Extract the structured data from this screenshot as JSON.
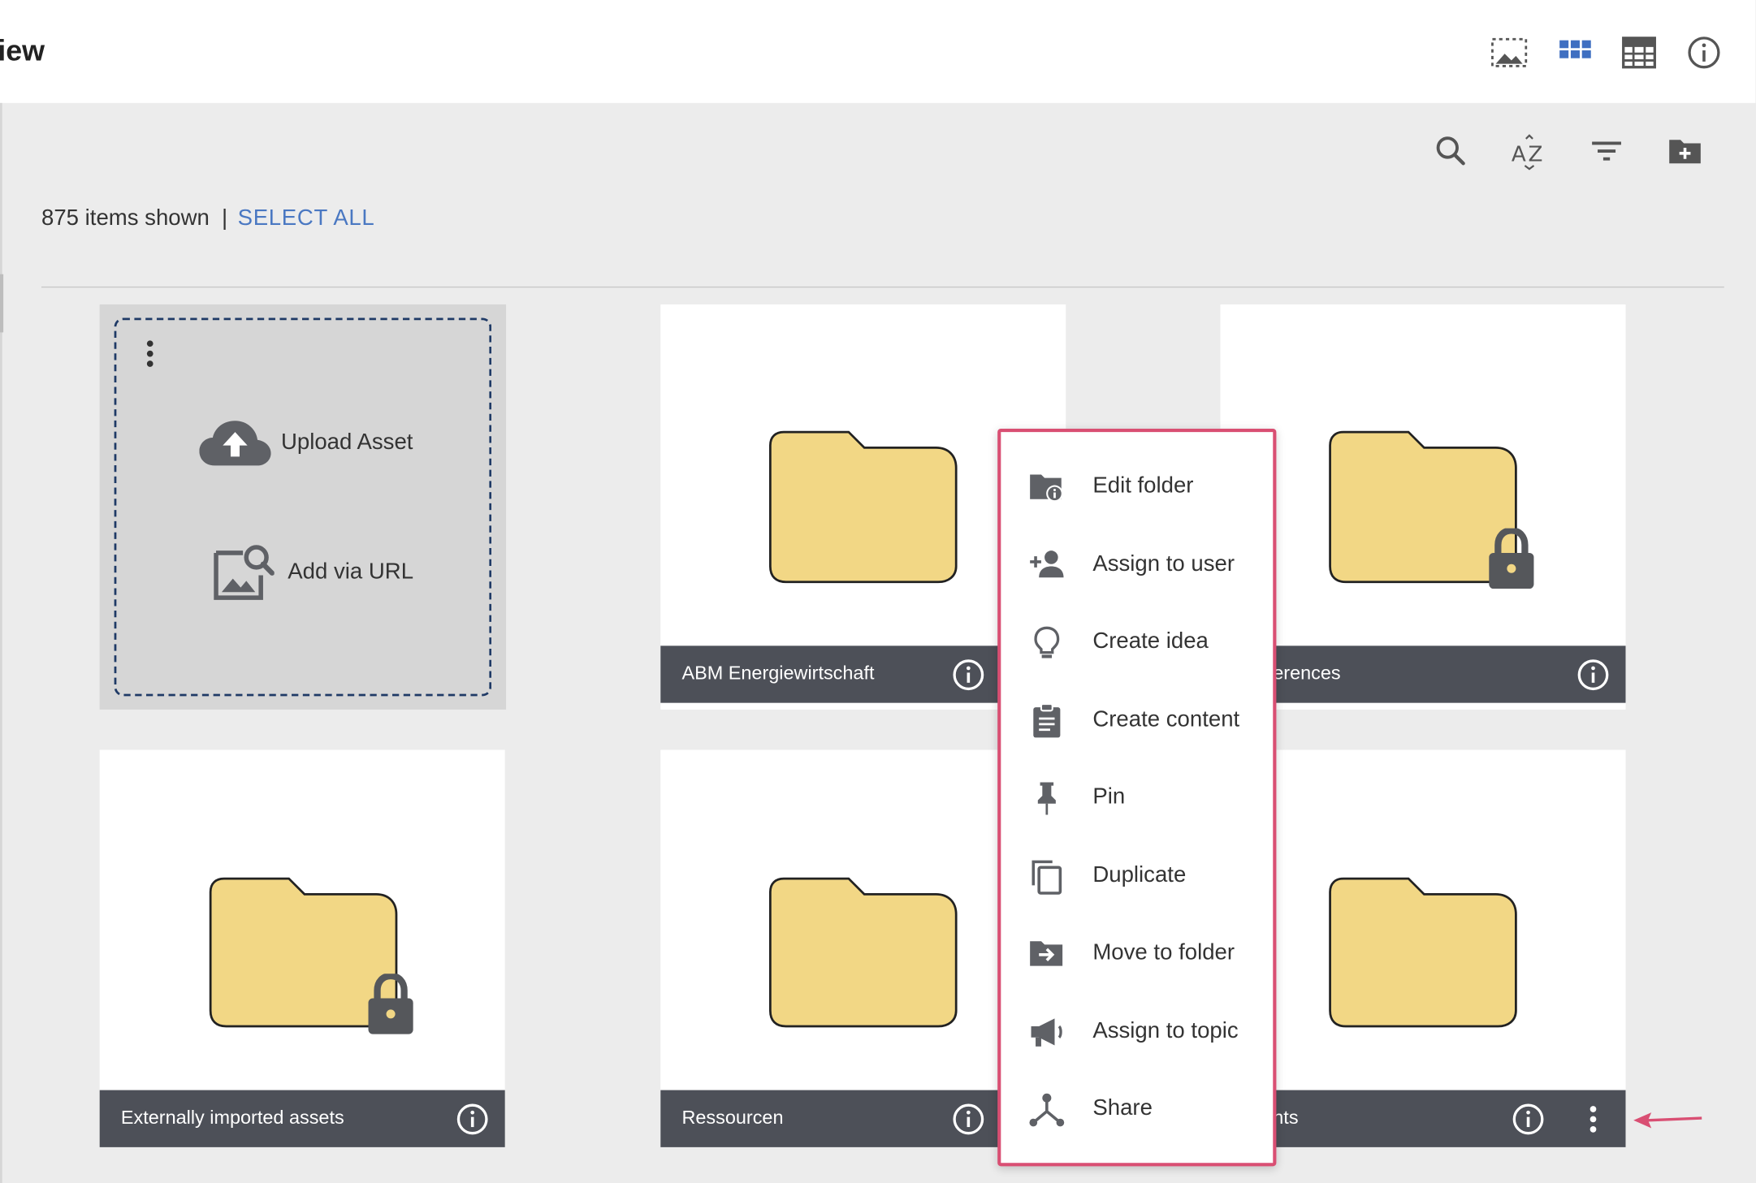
{
  "header": {
    "title_fragment": "iew",
    "view_icons": [
      "image-placeholder-icon",
      "grid-view-icon",
      "table-view-icon",
      "info-icon"
    ]
  },
  "toolbar": {
    "icons": [
      "search-icon",
      "sort-az-icon",
      "filter-icon",
      "new-folder-icon"
    ]
  },
  "listing": {
    "items_shown": "875 items shown",
    "separator": "|",
    "select_all": "SELECT ALL"
  },
  "upload_card": {
    "upload_label": "Upload Asset",
    "url_label": "Add via URL"
  },
  "cards": [
    {
      "label": "ABM Energiewirtschaft",
      "locked": false
    },
    {
      "label": "erences",
      "locked": true
    },
    {
      "label": "Externally imported assets",
      "locked": true
    },
    {
      "label": "Ressourcen",
      "locked": false
    },
    {
      "label": "nts",
      "locked": false
    }
  ],
  "context_menu": {
    "items": [
      {
        "label": "Edit folder",
        "icon": "edit-folder-icon"
      },
      {
        "label": "Assign to user",
        "icon": "add-user-icon"
      },
      {
        "label": "Create idea",
        "icon": "lightbulb-icon"
      },
      {
        "label": "Create content",
        "icon": "clipboard-icon"
      },
      {
        "label": "Pin",
        "icon": "pin-icon"
      },
      {
        "label": "Duplicate",
        "icon": "duplicate-icon"
      },
      {
        "label": "Move to folder",
        "icon": "move-to-folder-icon"
      },
      {
        "label": "Assign to topic",
        "icon": "megaphone-icon"
      },
      {
        "label": "Share",
        "icon": "share-icon"
      }
    ]
  },
  "colors": {
    "accent_blue": "#4a78c2",
    "folder_fill": "#f2d785",
    "caption_bg": "#4d5058",
    "menu_border": "#d94f73",
    "annotation_arrow": "#d94f73"
  }
}
